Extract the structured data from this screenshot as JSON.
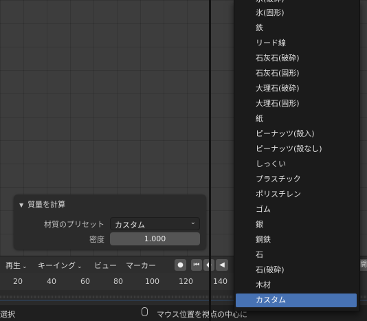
{
  "operator_panel": {
    "title": "質量を計算",
    "preset_label": "材質のプリセット",
    "preset_value": "カスタム",
    "density_label": "密度",
    "density_value": "1.000"
  },
  "timeline": {
    "playback": "再生",
    "keying": "キーイング",
    "view": "ビュー",
    "marker": "マーカー",
    "right_button": "開",
    "ruler": [
      "20",
      "40",
      "60",
      "80",
      "100",
      "120",
      "140"
    ]
  },
  "status_bar": {
    "left": "選択",
    "hint": "マウス位置を視点の中心に"
  },
  "menu": {
    "items": [
      "氷(破砕)",
      "氷(固形)",
      "鉄",
      "リード線",
      "石灰石(破砕)",
      "石灰石(固形)",
      "大理石(破砕)",
      "大理石(固形)",
      "紙",
      "ピーナッツ(殻入)",
      "ピーナッツ(殻なし)",
      "しっくい",
      "プラスチック",
      "ポリスチレン",
      "ゴム",
      "銀",
      "鋼鉄",
      "石",
      "石(破砕)",
      "木材",
      "カスタム"
    ],
    "selected_index": 20,
    "selected_color": "#4772b3"
  }
}
